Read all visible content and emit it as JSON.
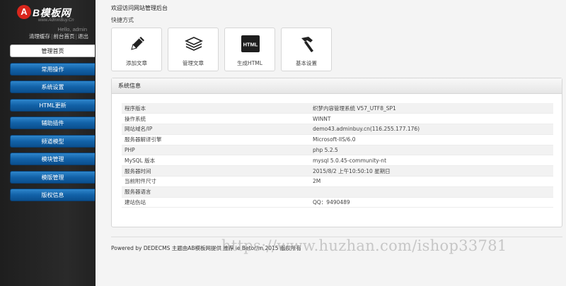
{
  "brand": {
    "logo_letter": "A",
    "logo_text": "B模板网",
    "logo_sub": "www.AdminBuy.Cn"
  },
  "user": {
    "hello": "Hello, admin",
    "links": [
      "清理缓存",
      "前台首页",
      "退出"
    ]
  },
  "nav": {
    "items": [
      {
        "label": "管理首页",
        "active": true
      },
      {
        "label": "常用操作"
      },
      {
        "label": "系统设置"
      },
      {
        "label": "HTML更新"
      },
      {
        "label": "辅助插件"
      },
      {
        "label": "频道模型"
      },
      {
        "label": "模块管理"
      },
      {
        "label": "模版管理"
      },
      {
        "label": "版权信息"
      }
    ]
  },
  "main": {
    "welcome": "欢迎访问网站管理后台",
    "shortcut_title": "快捷方式",
    "shortcuts": [
      {
        "label": "添加文章",
        "icon": "pencil-icon"
      },
      {
        "label": "管理文章",
        "icon": "stack-icon"
      },
      {
        "label": "生成HTML",
        "icon": "html-icon",
        "icon_text": "HTML"
      },
      {
        "label": "基本设置",
        "icon": "hammer-icon"
      }
    ],
    "sysinfo": {
      "title": "系统信息",
      "rows": [
        {
          "k": "程序版本",
          "v": "织梦内容管理系统 V57_UTF8_SP1"
        },
        {
          "k": "操作系统",
          "v": "WINNT"
        },
        {
          "k": "网站域名/IP",
          "v": "demo43.adminbuy.cn(116.255.177.176)"
        },
        {
          "k": "服务器解译引擎",
          "v": "Microsoft-IIS/6.0"
        },
        {
          "k": "PHP",
          "v": "php 5.2.5"
        },
        {
          "k": "MySQL 版本",
          "v": "mysql 5.0.45-community-nt"
        },
        {
          "k": "服务器时间",
          "v": "2015/8/2 上午10:50:10 星期日"
        },
        {
          "k": "当前附件尺寸",
          "v": "2M"
        },
        {
          "k": "服务器语言",
          "v": ""
        },
        {
          "k": "建站伤站",
          "v": "QQ：9490489"
        }
      ]
    },
    "footer": "Powered by DEDECMS 主题由AB模板网提供 推荐 ie Betor/m 2015 版权所有",
    "watermark": "https://www.huzhan.com/ishop33781"
  },
  "colors": {
    "sidebar": "#222222",
    "nav_blue": "#1262a8",
    "logo_red": "#d9261c"
  }
}
